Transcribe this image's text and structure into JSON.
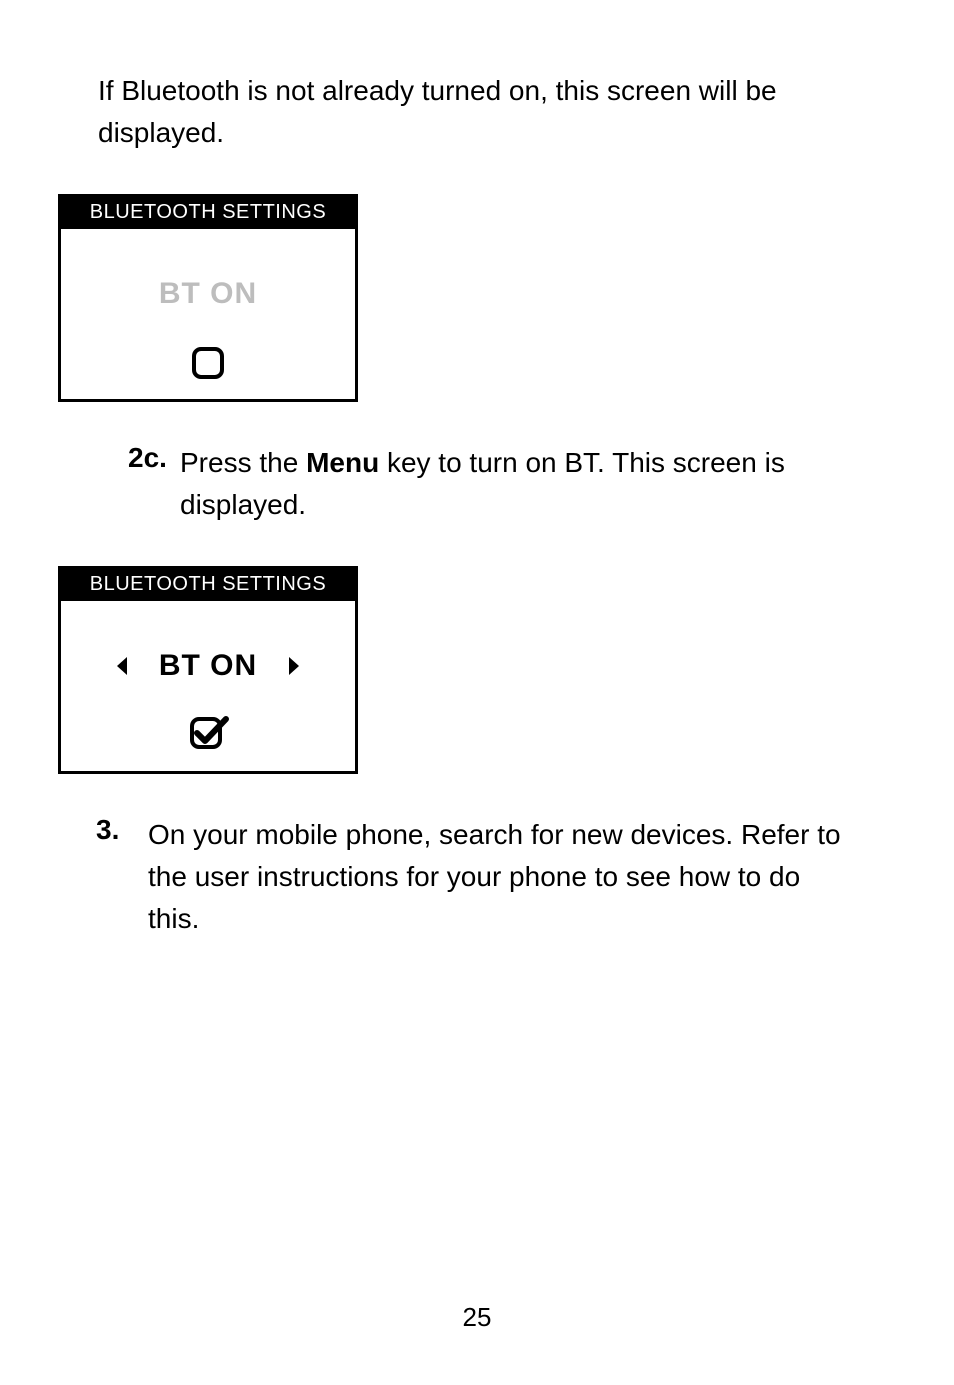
{
  "intro": "If Bluetooth is not already turned on, this screen will be displayed.",
  "screen1": {
    "header": "BLUETOOTH SETTINGS",
    "label": "BT ON"
  },
  "step2c": {
    "num": "2c.",
    "pre": " Press the ",
    "bold": "Menu",
    "post": " key to turn on BT. This screen is displayed."
  },
  "screen2": {
    "header": "BLUETOOTH SETTINGS",
    "label": "BT ON"
  },
  "step3": {
    "num": "3.",
    "text": " On your mobile phone, search for new devices. Refer to the user instructions for your phone to see how to do this."
  },
  "pageNumber": "25"
}
